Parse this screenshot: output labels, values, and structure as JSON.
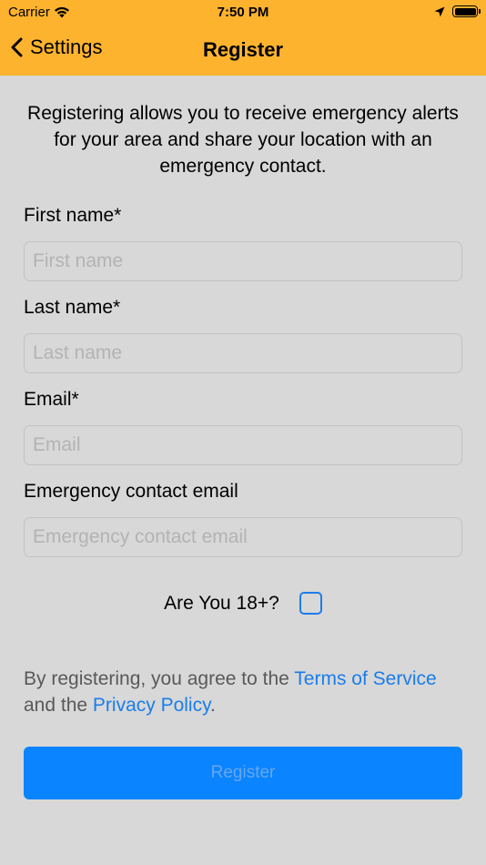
{
  "status_bar": {
    "carrier": "Carrier",
    "time": "7:50 PM"
  },
  "nav": {
    "back_label": "Settings",
    "title": "Register"
  },
  "intro": "Registering allows you to receive emergency alerts for your area and share your location with an emergency contact.",
  "form": {
    "fields": [
      {
        "label": "First name*",
        "placeholder": "First name",
        "value": ""
      },
      {
        "label": "Last name*",
        "placeholder": "Last name",
        "value": ""
      },
      {
        "label": "Email*",
        "placeholder": "Email",
        "value": ""
      },
      {
        "label": "Emergency contact email",
        "placeholder": "Emergency contact email",
        "value": ""
      }
    ],
    "age_label": "Are You 18+?",
    "age_checked": false
  },
  "terms": {
    "prefix": "By registering, you agree to the ",
    "terms_link": "Terms of Service",
    "middle": " and the ",
    "privacy_link": "Privacy Policy",
    "suffix": "."
  },
  "register_button": "Register",
  "colors": {
    "nav_background": "#fdb32e",
    "accent": "#0a84ff",
    "link": "#1a7dea",
    "page_background": "#d8d8d8"
  }
}
